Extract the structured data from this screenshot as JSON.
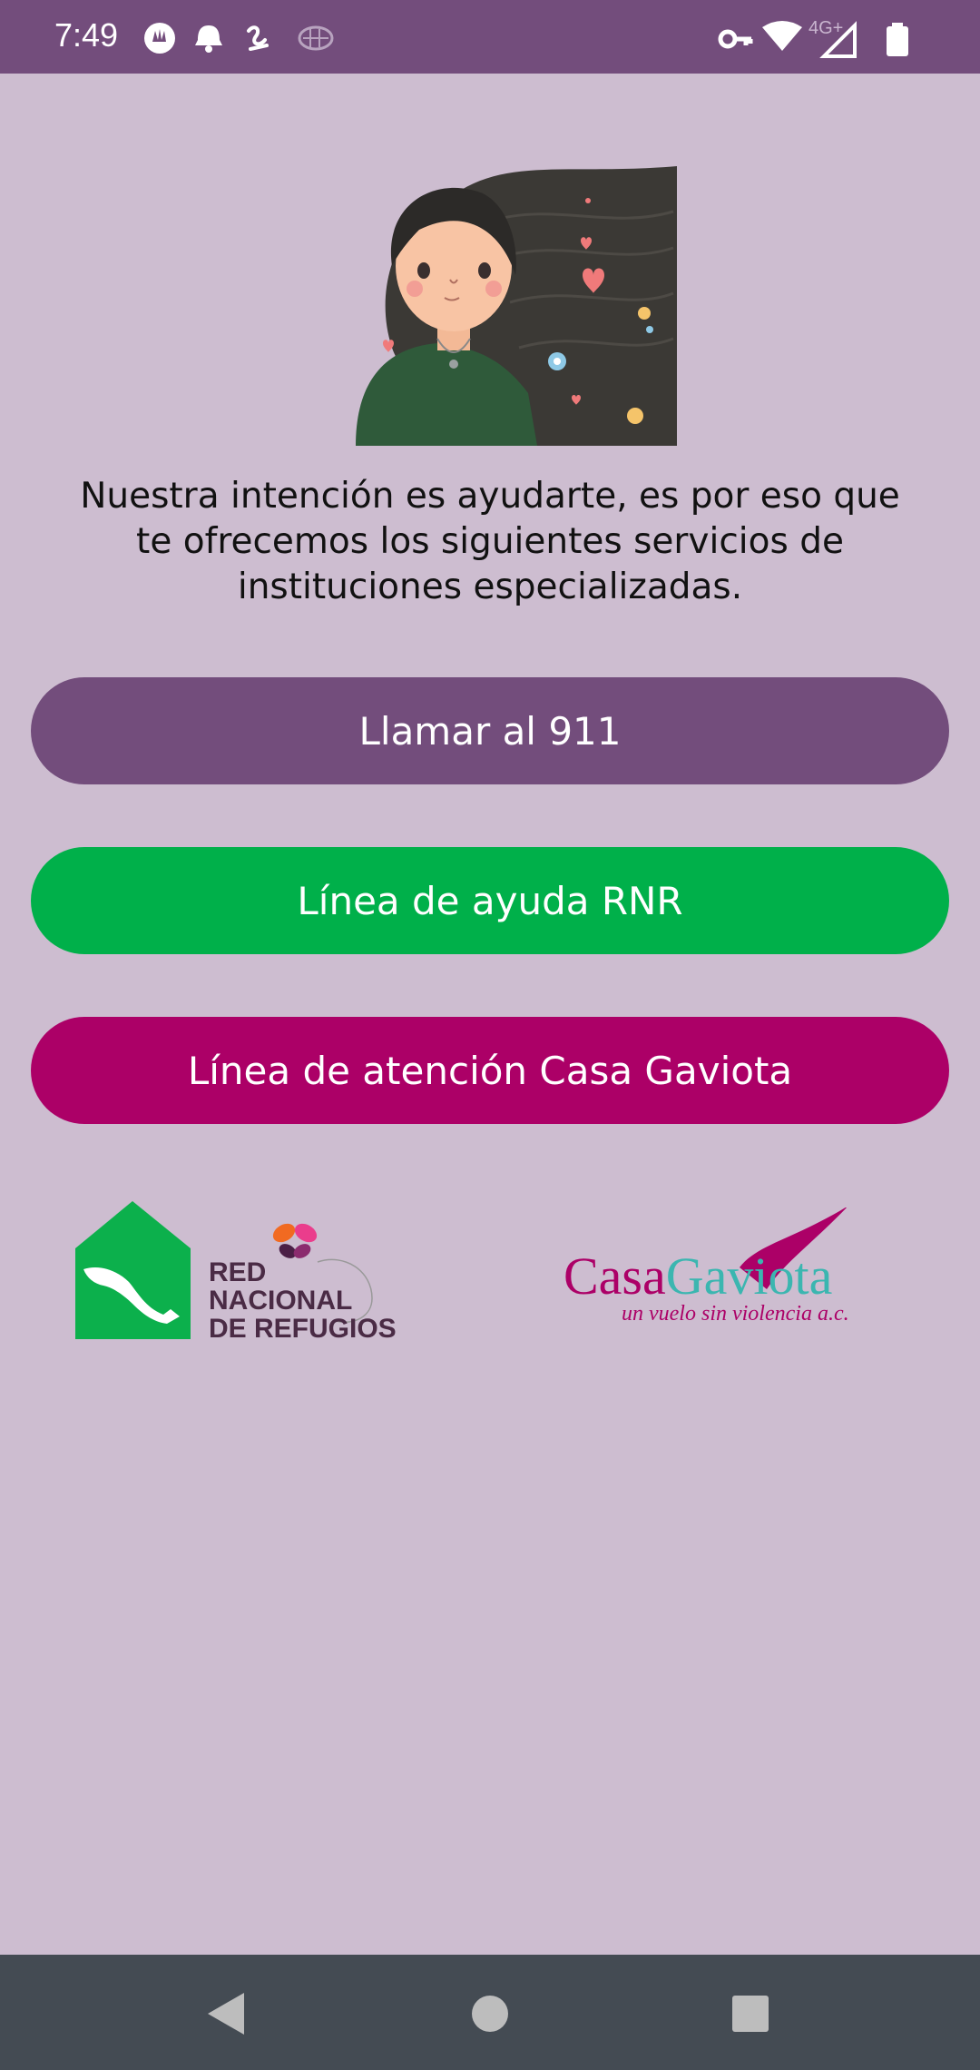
{
  "status": {
    "time": "7:49",
    "network": "4G+",
    "icons_left": [
      "hand-icon",
      "bell-icon",
      "swirl-icon",
      "brain-icon"
    ],
    "icons_right": [
      "key-icon",
      "wifi-icon",
      "signal-icon",
      "battery-icon"
    ]
  },
  "main": {
    "intro": "Nuestra intención es ayudarte, es por eso que te ofrecemos los siguientes servicios de instituciones especializadas.",
    "buttons": [
      {
        "label": "Llamar al 911",
        "color": "#734d7c"
      },
      {
        "label": "Línea de ayuda RNR",
        "color": "#00b04a"
      },
      {
        "label": "Línea de atención Casa Gaviota",
        "color": "#ac0067"
      }
    ]
  },
  "logos": {
    "rnr": {
      "line1": "RED",
      "line2": "NACIONAL",
      "line3": "DE REFUGIOS"
    },
    "gaviota": {
      "name_part1": "Casa",
      "name_part2": "Gaviota",
      "tagline": "un vuelo sin violencia a.c."
    }
  },
  "nav": {
    "icons": [
      "back-icon",
      "home-icon",
      "recents-icon"
    ]
  },
  "colors": {
    "accent": "#734d7c",
    "green": "#00b04a",
    "magenta": "#ac0067",
    "background": "#cdbdd0"
  }
}
